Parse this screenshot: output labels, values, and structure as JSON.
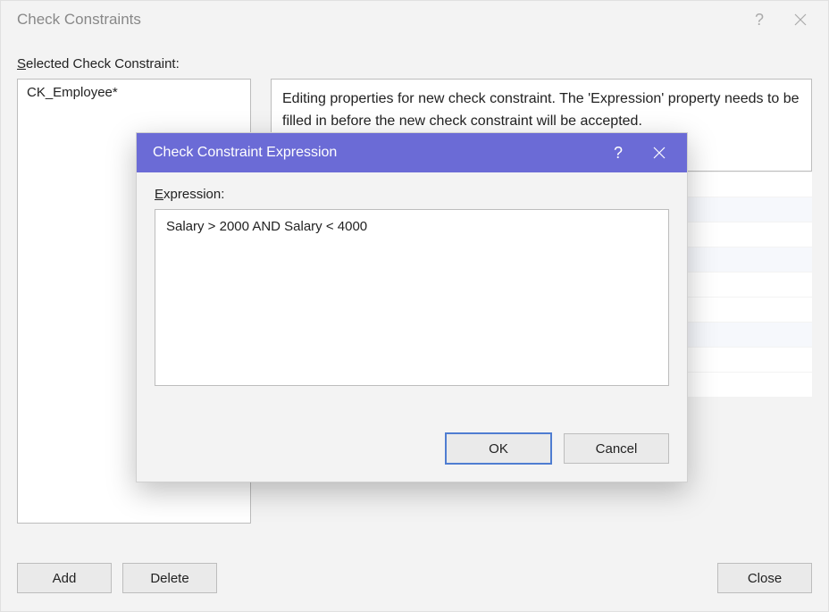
{
  "main_dialog": {
    "title": "Check Constraints",
    "help_glyph": "?",
    "selected_label": "Selected Check Constraint:",
    "constraint_items": [
      "CK_Employee*"
    ],
    "description_text": "Editing properties for new check constraint.  The 'Expression' property needs to be filled in before the new check constraint will be accepted.",
    "add_label": "Add",
    "delete_label": "Delete",
    "close_label": "Close"
  },
  "modal": {
    "title": "Check Constraint Expression",
    "help_glyph": "?",
    "expression_label": "Expression:",
    "expression_value": "Salary > 2000 AND Salary < 4000",
    "ok_label": "OK",
    "cancel_label": "Cancel"
  }
}
